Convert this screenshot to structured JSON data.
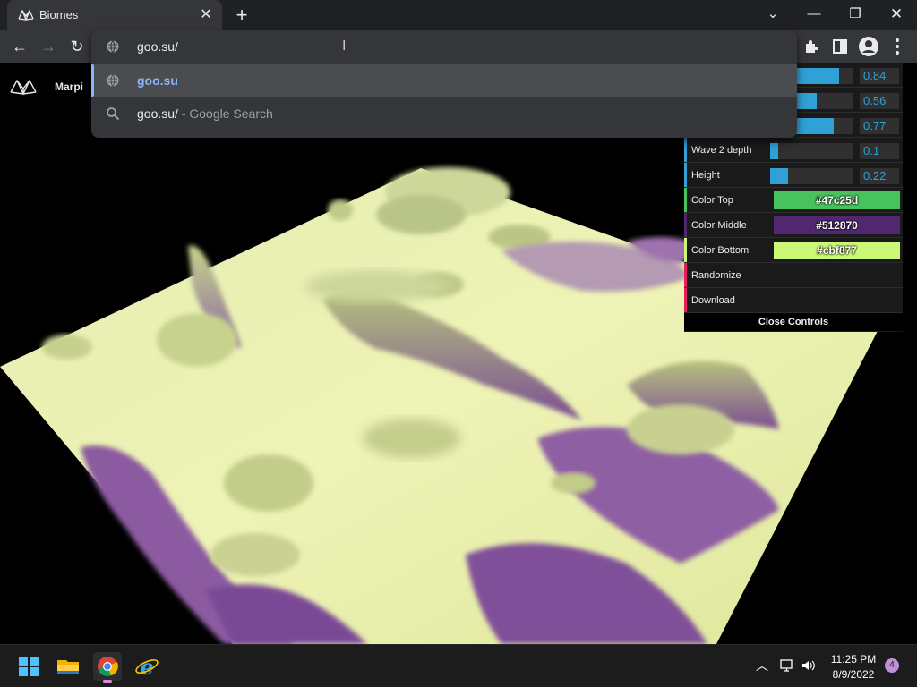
{
  "tab": {
    "title": "Biomes",
    "close_icon": "close-icon"
  },
  "window_controls": {
    "minimize": "minimize-icon",
    "maximize": "restore-icon",
    "close": "close-icon",
    "tab_search": "chevron-down-icon"
  },
  "omnibox": {
    "input_value": "goo.su/",
    "suggestions": [
      {
        "text": "goo.su",
        "subtext": "",
        "icon": "globe-icon"
      },
      {
        "text": "goo.su/",
        "subtext": "- Google Search",
        "icon": "search-icon"
      }
    ]
  },
  "site": {
    "name": "Marpi"
  },
  "controls": {
    "sliders_top": [
      {
        "value": "0.84",
        "fraction": 0.84
      },
      {
        "value": "0.56",
        "fraction": 0.56
      },
      {
        "value": "0.77",
        "fraction": 0.77
      }
    ],
    "sliders": [
      {
        "label": "Wave 2 depth",
        "value": "0.1",
        "fraction": 0.1
      },
      {
        "label": "Height",
        "value": "0.22",
        "fraction": 0.22
      }
    ],
    "colors": [
      {
        "label": "Color Top",
        "value": "#47c25d",
        "swatch": "#47c25d",
        "text_color": "#ffffff",
        "accent": "#47c25d"
      },
      {
        "label": "Color Middle",
        "value": "#512870",
        "swatch": "#512870",
        "text_color": "#ffffff",
        "accent": "#512870"
      },
      {
        "label": "Color Bottom",
        "value": "#cbf877",
        "swatch": "#cbf877",
        "text_color": "#ffffff",
        "accent": "#cbf877"
      }
    ],
    "buttons": [
      {
        "label": "Randomize"
      },
      {
        "label": "Download"
      }
    ],
    "close_label": "Close Controls"
  },
  "taskbar": {
    "time": "11:25 PM",
    "date": "8/9/2022",
    "notification_count": "4"
  },
  "colors": {
    "terrain_base": "#e9efa8",
    "terrain_mid": "#9a6aa8",
    "slider_accent": "#2fa1d6"
  }
}
